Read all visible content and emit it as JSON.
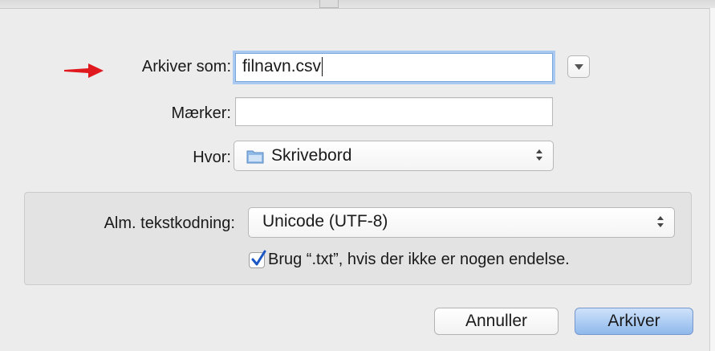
{
  "dialog": {
    "save_as_label": "Arkiver som:",
    "filename_value": "filnavn.csv",
    "tags_label": "Mærker:",
    "tags_value": "",
    "where_label": "Hvor:",
    "where_value": "Skrivebord",
    "where_icon": "folder-icon",
    "expand_icon": "chevron-down-icon",
    "annotation_icon": "red-arrow-icon"
  },
  "options": {
    "encoding_label": "Alm. tekstkodning:",
    "encoding_value": "Unicode (UTF-8)",
    "txt_checkbox_label": "Brug “.txt”, hvis der ikke er nogen endelse.",
    "txt_checkbox_checked": true
  },
  "buttons": {
    "cancel_label": "Annuller",
    "save_label": "Arkiver"
  },
  "colors": {
    "accent_focus": "#7aa7db",
    "default_button": "#8fb9ec",
    "arrow": "#e0191e"
  }
}
